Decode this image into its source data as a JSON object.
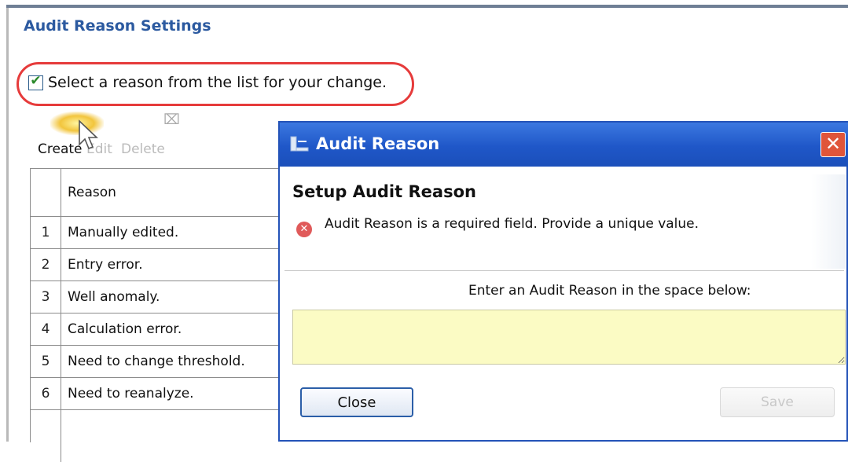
{
  "panel": {
    "title": "Audit Reason Settings",
    "checkbox_label": "Select a reason from the list for your change.",
    "checkbox_checked": true
  },
  "toolbar": {
    "create_label": "Create",
    "edit_label": "Edit",
    "delete_label": "Delete"
  },
  "table": {
    "header": "Reason",
    "rows": [
      {
        "num": "1",
        "reason": "Manually edited."
      },
      {
        "num": "2",
        "reason": "Entry error."
      },
      {
        "num": "3",
        "reason": "Well anomaly."
      },
      {
        "num": "4",
        "reason": "Calculation error."
      },
      {
        "num": "5",
        "reason": "Need to change threshold."
      },
      {
        "num": "6",
        "reason": "Need to reanalyze."
      }
    ]
  },
  "dialog": {
    "title": "Audit Reason",
    "heading": "Setup Audit Reason",
    "error_message": "Audit Reason is a required field. Provide a unique value.",
    "prompt": "Enter an Audit Reason in the space below:",
    "input_value": "",
    "close_button": "Close",
    "save_button": "Save"
  },
  "colors": {
    "title_blue": "#2c5aa0",
    "highlight_red": "#e63b3b",
    "titlebar_blue": "#1f57c8",
    "input_yellow": "#fbfbc4"
  },
  "icons": {
    "checkbox": "check-icon",
    "create": "create-icon",
    "delete": "delete-icon",
    "dialog_app": "app-icon",
    "dialog_close": "close-icon",
    "error": "error-icon",
    "cursor": "mouse-cursor-icon"
  }
}
